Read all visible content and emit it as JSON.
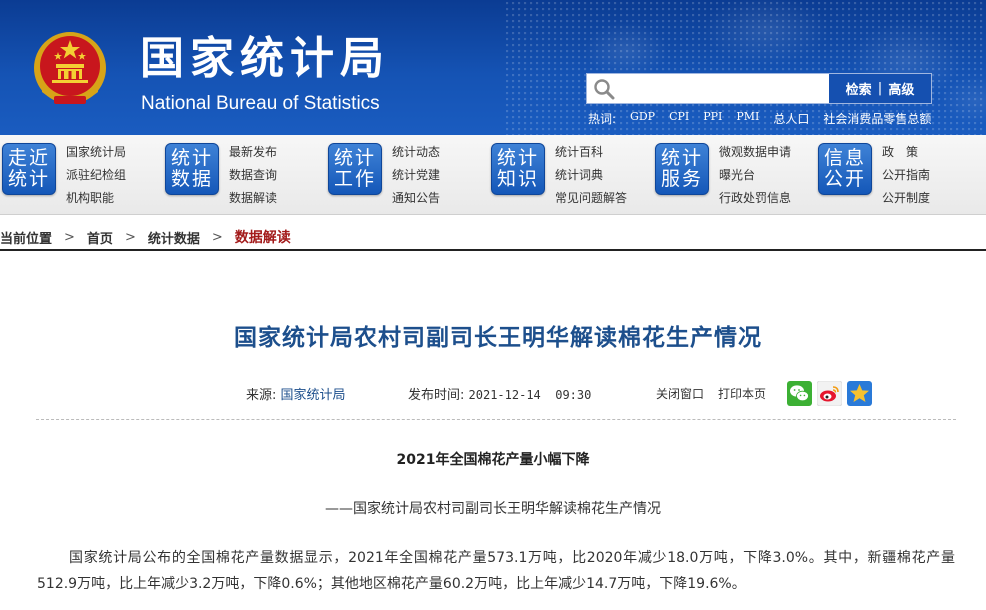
{
  "header": {
    "title_cn": "国家统计局",
    "title_en": "National Bureau of Statistics",
    "search": {
      "placeholder": "",
      "search_label": "检索",
      "separator": "|",
      "advanced_label": "高级"
    },
    "hot": {
      "label": "热词:",
      "keywords": [
        "GDP",
        "CPI",
        "PPI",
        "PMI",
        "总人口",
        "社会消费品零售总额"
      ]
    }
  },
  "nav": {
    "groups": [
      {
        "badge": [
          "走近",
          "统计"
        ],
        "links": [
          "国家统计局",
          "派驻纪检组",
          "机构职能"
        ]
      },
      {
        "badge": [
          "统计",
          "数据"
        ],
        "links": [
          "最新发布",
          "数据查询",
          "数据解读"
        ]
      },
      {
        "badge": [
          "统计",
          "工作"
        ],
        "links": [
          "统计动态",
          "统计党建",
          "通知公告"
        ]
      },
      {
        "badge": [
          "统计",
          "知识"
        ],
        "links": [
          "统计百科",
          "统计词典",
          "常见问题解答"
        ]
      },
      {
        "badge": [
          "统计",
          "服务"
        ],
        "links": [
          "微观数据申请",
          "曝光台",
          "行政处罚信息"
        ]
      },
      {
        "badge": [
          "信息",
          "公开"
        ],
        "links": [
          "政　策",
          "公开指南",
          "公开制度"
        ]
      }
    ]
  },
  "breadcrumb": {
    "items": [
      "当前位置",
      "首页",
      "统计数据",
      "数据解读"
    ],
    "arrow": ">"
  },
  "article": {
    "title": "国家统计局农村司副司长王明华解读棉花生产情况",
    "source_label": "来源:",
    "source_value": "国家统计局",
    "pubtime_label": "发布时间:",
    "pubtime_value": "2021-12-14  09:30",
    "close_window": "关闭窗口",
    "print_page": "打印本页",
    "share_icons": [
      "wechat-icon",
      "weibo-icon",
      "qzone-icon"
    ],
    "subheading": "2021年全国棉花产量小幅下降",
    "subheading2": "——国家统计局农村司副司长王明华解读棉花生产情况",
    "paragraph": "国家统计局公布的全国棉花产量数据显示，2021年全国棉花产量573.1万吨，比2020年减少18.0万吨，下降3.0%。其中，新疆棉花产量512.9万吨，比上年减少3.2万吨，下降0.6%；其他地区棉花产量60.2万吨，比上年减少14.7万吨，下降19.6%。"
  },
  "colors": {
    "header_blue": "#1553b4",
    "title_blue": "#1d4f8c",
    "current_crumb_red": "#a31b1b"
  }
}
